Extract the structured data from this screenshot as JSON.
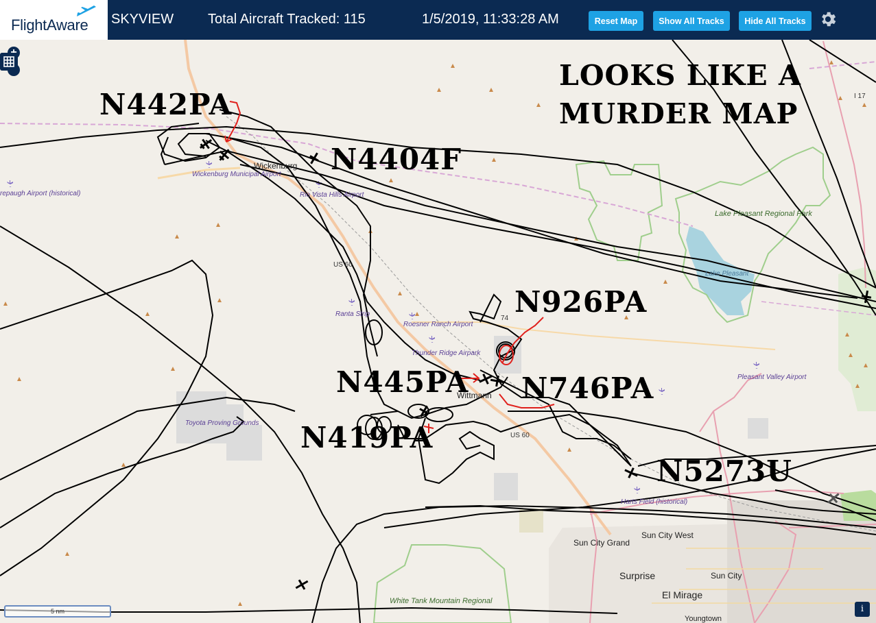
{
  "header": {
    "logo_text": "FlightAware",
    "app_name": "SKYVIEW",
    "total_tracked": "Total Aircraft Tracked: 115",
    "datetime": "1/5/2019, 11:33:28 AM",
    "buttons": {
      "reset": "Reset Map",
      "show_tracks": "Show All Tracks",
      "hide_tracks": "Hide All Tracks"
    }
  },
  "annotation": {
    "line1": "LOOKS LIKE A",
    "line2": "MURDER MAP"
  },
  "aircraft_labels": [
    "N442PA",
    "N4404F",
    "N926PA",
    "N445PA",
    "N746PA",
    "N419PA",
    "N5273U"
  ],
  "map_labels": {
    "towns": [
      "Wickenburg",
      "Wittmann",
      "Surprise",
      "El Mirage",
      "Sun City",
      "Sun City West",
      "Sun City Grand",
      "Youngtown"
    ],
    "airports": [
      "Wickenburg Municipal Airport",
      "Rio Vista Hills Airport",
      "Ranta Strip",
      "Roesner Ranch Airport",
      "Thunder Ridge Airpark",
      "Pleasant Valley Airport",
      "Harts Field (historical)",
      "Toyota Proving Grounds",
      "repaugh Airport (historical)"
    ],
    "parks": [
      "Lake Pleasant Regional Park",
      "Lake Pleasant",
      "White Tank Mountain Regional"
    ],
    "roads": [
      "US 60",
      "US 60",
      "I 17",
      "74"
    ]
  },
  "controls": {
    "zoom_in": "+",
    "zoom_out": "−",
    "scale": "5 nm",
    "info": "i"
  },
  "colors": {
    "header_bg": "#0b2a52",
    "button_blue": "#1ea2e4",
    "track": "#000000",
    "marker_red": "#e0201c",
    "map_bg": "#f2efe9"
  }
}
